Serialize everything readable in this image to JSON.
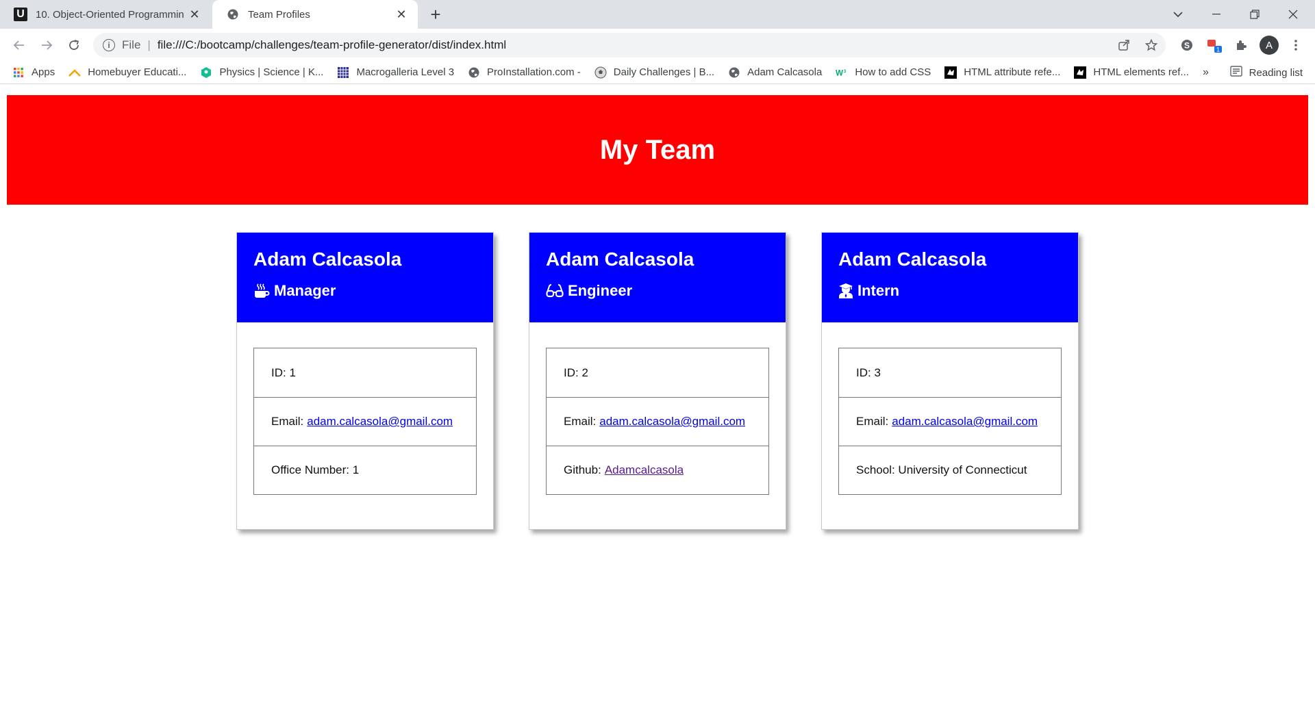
{
  "browser": {
    "tabs": [
      {
        "title": "10. Object-Oriented Programmin",
        "favicon": "udemy-u-icon",
        "active": false
      },
      {
        "title": "Team Profiles",
        "favicon": "globe-icon",
        "active": true
      }
    ],
    "url_scheme": "File",
    "url": "file:///C:/bootcamp/challenges/team-profile-generator/dist/index.html",
    "profile_initial": "A",
    "extension_badge": "1",
    "bookmarks": [
      {
        "label": "Apps",
        "icon": "apps-grid-icon"
      },
      {
        "label": "Homebuyer Educati...",
        "icon": "roof-icon"
      },
      {
        "label": "Physics | Science | K...",
        "icon": "khan-academy-icon"
      },
      {
        "label": "Macrogalleria Level 3",
        "icon": "grid-building-icon"
      },
      {
        "label": "ProInstallation.com -",
        "icon": "globe-icon"
      },
      {
        "label": "Daily Challenges | B...",
        "icon": "soccer-ball-icon"
      },
      {
        "label": "Adam Calcasola",
        "icon": "globe-icon"
      },
      {
        "label": "How to add CSS",
        "icon": "w3schools-icon"
      },
      {
        "label": "HTML attribute refe...",
        "icon": "mdn-icon"
      },
      {
        "label": "HTML elements ref...",
        "icon": "mdn-icon"
      }
    ],
    "overflow_chevron": "»",
    "reading_list": "Reading list"
  },
  "page": {
    "header": "My Team",
    "colors": {
      "header_bg": "#ff0000",
      "card_head_bg": "#0000ff"
    },
    "cards": [
      {
        "name": "Adam Calcasola",
        "role": "Manager",
        "role_icon": "mug-hot-icon",
        "id_label": "ID: 1",
        "email_label": "Email:",
        "email": "adam.calcasola@gmail.com",
        "extra_label": "Office Number: 1",
        "extra_link": ""
      },
      {
        "name": "Adam Calcasola",
        "role": "Engineer",
        "role_icon": "glasses-icon",
        "id_label": "ID: 2",
        "email_label": "Email:",
        "email": "adam.calcasola@gmail.com",
        "extra_label": "Github:",
        "extra_link": "Adamcalcasola"
      },
      {
        "name": "Adam Calcasola",
        "role": "Intern",
        "role_icon": "user-graduate-icon",
        "id_label": "ID: 3",
        "email_label": "Email:",
        "email": "adam.calcasola@gmail.com",
        "extra_label": "School: University of Connecticut",
        "extra_link": ""
      }
    ]
  }
}
